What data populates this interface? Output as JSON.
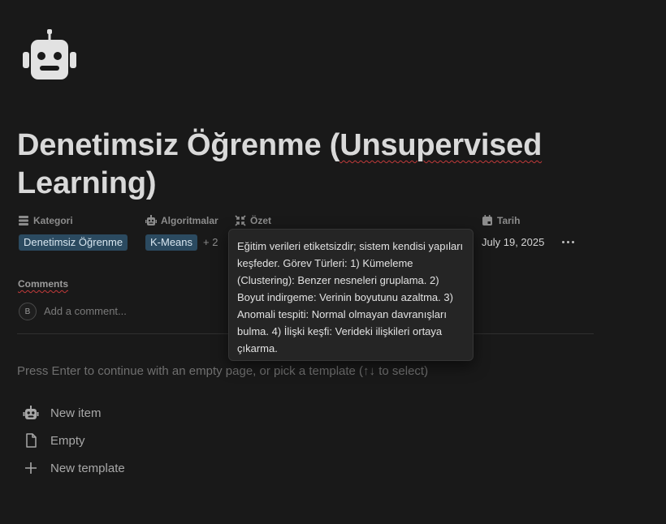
{
  "page": {
    "icon": "robot-icon",
    "title_line1": "Denetimsiz Öğrenme (",
    "title_underlined": "Unsupervised",
    "title_line2": "Learning)"
  },
  "properties": {
    "kategori": {
      "label": "Kategori",
      "icon": "list-icon",
      "tag": "Denetimsiz Öğrenme"
    },
    "algoritmalar": {
      "label": "Algoritmalar",
      "icon": "robot-icon",
      "tag": "K-Means",
      "more": "+ 2"
    },
    "ozet": {
      "label": "Özet",
      "icon": "collapse-icon"
    },
    "tarih": {
      "label": "Tarih",
      "icon": "calendar-icon",
      "value": "July 19, 2025"
    }
  },
  "tooltip": {
    "text": "Eğitim verileri etiketsizdir; sistem kendisi yapıları keşfeder. Görev Türleri: 1) Kümeleme (Clustering): Benzer nesneleri gruplama. 2) Boyut indirgeme: Verinin boyutunu azaltma. 3) Anomali tespiti: Normal olmayan davranışları bulma. 4) İlişki keşfi: Verideki ilişkileri ortaya çıkarma."
  },
  "comments": {
    "label": "Comments",
    "avatar_initial": "B",
    "placeholder": "Add a comment..."
  },
  "hint": "Press Enter to continue with an empty page, or pick a template (↑↓ to select)",
  "templates": [
    {
      "label": "New item",
      "icon": "robot-icon"
    },
    {
      "label": "Empty",
      "icon": "page-icon"
    },
    {
      "label": "New template",
      "icon": "plus-icon"
    }
  ],
  "colors": {
    "background": "#191919",
    "tag_bg": "#2b4a60",
    "spellcheck": "#c23a3a"
  }
}
